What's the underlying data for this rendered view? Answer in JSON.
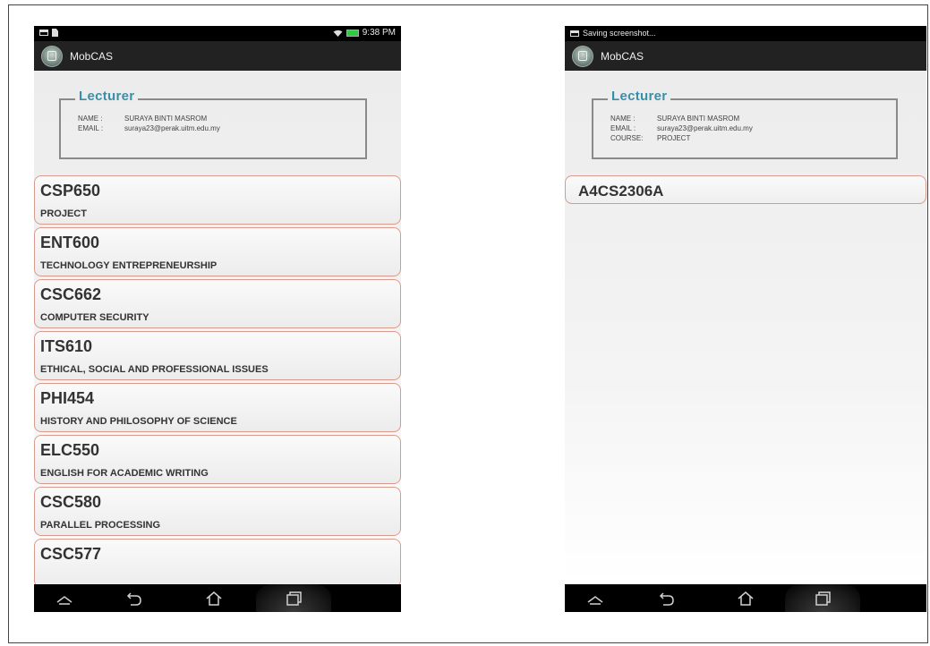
{
  "left_phone": {
    "status_time": "9:38 PM",
    "app_title": "MobCAS",
    "lecturer": {
      "title": "Lecturer",
      "name_label": "NAME :",
      "name_value": "SURAYA BINTI MASROM",
      "email_label": "EMAIL :",
      "email_value": "suraya23@perak.uitm.edu.my"
    },
    "courses": [
      {
        "code": "CSP650",
        "name": "PROJECT"
      },
      {
        "code": "ENT600",
        "name": "TECHNOLOGY ENTREPRENEURSHIP"
      },
      {
        "code": "CSC662",
        "name": "COMPUTER SECURITY"
      },
      {
        "code": "ITS610",
        "name": "ETHICAL, SOCIAL AND PROFESSIONAL ISSUES"
      },
      {
        "code": "PHI454",
        "name": "HISTORY AND PHILOSOPHY OF SCIENCE"
      },
      {
        "code": "ELC550",
        "name": "ENGLISH FOR ACADEMIC WRITING"
      },
      {
        "code": "CSC580",
        "name": "PARALLEL PROCESSING"
      },
      {
        "code": "CSC577",
        "name": ""
      }
    ]
  },
  "right_phone": {
    "status_text": "Saving screenshot...",
    "app_title": "MobCAS",
    "lecturer": {
      "title": "Lecturer",
      "name_label": "NAME :",
      "name_value": "SURAYA BINTI MASROM",
      "email_label": "EMAIL :",
      "email_value": "suraya23@perak.uitm.edu.my",
      "course_label": "COURSE:",
      "course_value": "PROJECT"
    },
    "groups": [
      {
        "code": "A4CS2306A"
      }
    ]
  },
  "icons": [
    "app-icon",
    "wifi-icon",
    "battery-icon",
    "screenshot-icon",
    "notification-icon",
    "hide-icon",
    "back-icon",
    "home-icon",
    "recent-apps-icon"
  ]
}
